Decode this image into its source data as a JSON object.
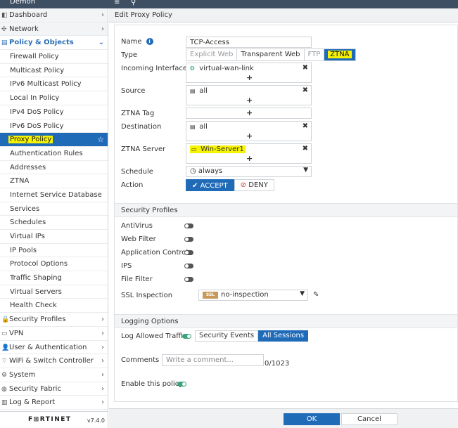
{
  "topbar": {
    "brand": "Demon",
    "menu_icon": "≡",
    "search_icon": "⚲"
  },
  "sidebar": {
    "items": [
      {
        "label": "Dashboard",
        "icon": "dashboard-icon",
        "level": "top",
        "chevron": "›"
      },
      {
        "label": "Network",
        "icon": "network-icon",
        "level": "top",
        "chevron": "›"
      },
      {
        "label": "Policy & Objects",
        "icon": "policy-icon",
        "level": "top",
        "chevron": "⌄",
        "expanded": true
      },
      {
        "label": "Firewall Policy"
      },
      {
        "label": "Multicast Policy"
      },
      {
        "label": "IPv6 Multicast Policy"
      },
      {
        "label": "Local In Policy"
      },
      {
        "label": "IPv4 DoS Policy"
      },
      {
        "label": "IPv6 DoS Policy"
      },
      {
        "label": "Proxy Policy",
        "selected": true,
        "chevron": "☆"
      },
      {
        "label": "Authentication Rules"
      },
      {
        "label": "Addresses"
      },
      {
        "label": "ZTNA"
      },
      {
        "label": "Internet Service Database"
      },
      {
        "label": "Services"
      },
      {
        "label": "Schedules"
      },
      {
        "label": "Virtual IPs"
      },
      {
        "label": "IP Pools"
      },
      {
        "label": "Protocol Options"
      },
      {
        "label": "Traffic Shaping"
      },
      {
        "label": "Virtual Servers"
      },
      {
        "label": "Health Check"
      },
      {
        "label": "Security Profiles",
        "icon": "lock-icon",
        "level": "top",
        "chevron": "›"
      },
      {
        "label": "VPN",
        "icon": "vpn-icon",
        "level": "top",
        "chevron": "›"
      },
      {
        "label": "User & Authentication",
        "icon": "user-icon",
        "level": "top",
        "chevron": "›"
      },
      {
        "label": "WiFi & Switch Controller",
        "icon": "wifi-icon",
        "level": "top",
        "chevron": "›"
      },
      {
        "label": "System",
        "icon": "gear-icon",
        "level": "top",
        "chevron": "›"
      },
      {
        "label": "Security Fabric",
        "icon": "fabric-icon",
        "level": "top",
        "chevron": "›"
      },
      {
        "label": "Log & Report",
        "icon": "chart-icon",
        "level": "top",
        "chevron": "›"
      }
    ],
    "logo": "F⊞RTINET",
    "version": "v7.4.0"
  },
  "header": {
    "title": "Edit Proxy Policy"
  },
  "form": {
    "name_label": "Name",
    "name_value": "TCP-Access",
    "type_label": "Type",
    "type_options": [
      "Explicit Web",
      "Transparent Web",
      "FTP",
      "ZTNA"
    ],
    "incoming_label": "Incoming Interface",
    "incoming_value": "virtual-wan-link",
    "source_label": "Source",
    "source_value": "all",
    "ztna_tag_label": "ZTNA Tag",
    "destination_label": "Destination",
    "destination_value": "all",
    "ztna_server_label": "ZTNA Server",
    "ztna_server_value": "Win-Server1",
    "schedule_label": "Schedule",
    "schedule_value": "always",
    "action_label": "Action",
    "accept_label": "ACCEPT",
    "deny_label": "DENY",
    "plus": "+",
    "remove": "✖"
  },
  "security_profiles": {
    "title": "Security Profiles",
    "items": [
      "AntiVirus",
      "Web Filter",
      "Application Control",
      "IPS",
      "File Filter"
    ],
    "ssl_label": "SSL Inspection",
    "ssl_badge": "SSL",
    "ssl_value": "no-inspection"
  },
  "logging": {
    "title": "Logging Options",
    "log_allowed_label": "Log Allowed Traffic",
    "options": [
      "Security Events",
      "All Sessions"
    ],
    "comments_label": "Comments",
    "comments_placeholder": "Write a comment...",
    "comments_count": "0/1023",
    "enable_label": "Enable this policy"
  },
  "footer": {
    "ok_label": "OK",
    "cancel_label": "Cancel"
  },
  "colors": {
    "accent": "#1f6bb8",
    "highlight": "#f7f400",
    "switch_on": "#3aa57a"
  }
}
